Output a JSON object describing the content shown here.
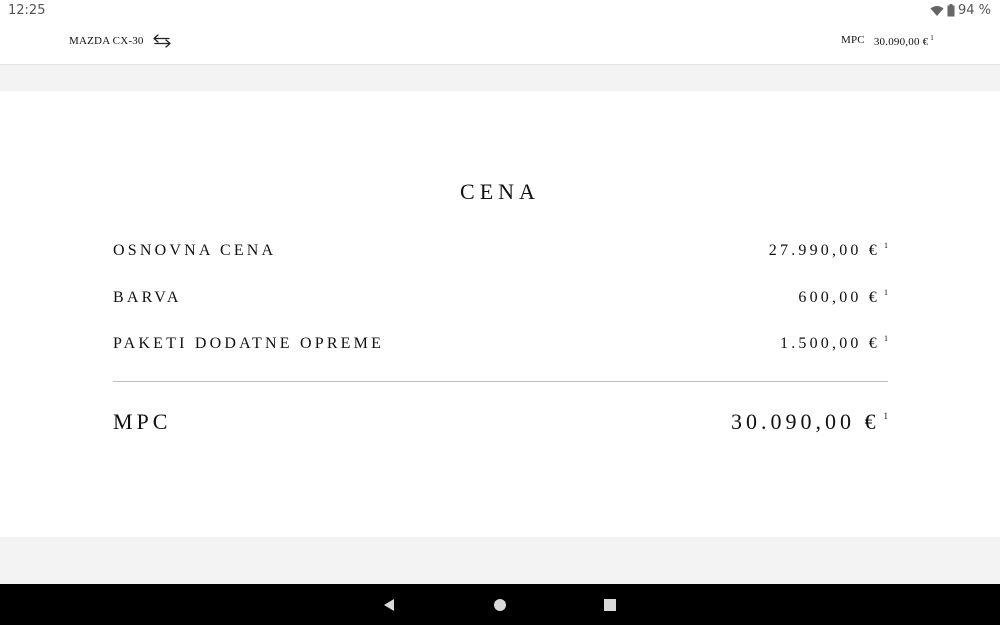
{
  "status_bar": {
    "time": "12:25",
    "battery": "94 %",
    "icons": [
      "wifi-icon",
      "battery-icon"
    ]
  },
  "header": {
    "model_name": "MAZDA CX-30",
    "price_label": "MPC",
    "price_value": "30.090,00 €",
    "footnote": "1"
  },
  "price_panel": {
    "title": "CENA",
    "rows": [
      {
        "label": "OSNOVNA CENA",
        "value": "27.990,00 €",
        "footnote": "1"
      },
      {
        "label": "BARVA",
        "value": "600,00 €",
        "footnote": "1"
      },
      {
        "label": "PAKETI DODATNE OPREME",
        "value": "1.500,00 €",
        "footnote": "1"
      }
    ],
    "total": {
      "label": "MPC",
      "value": "30.090,00 €",
      "footnote": "1"
    }
  },
  "nav_bar": {
    "buttons": [
      "back-icon",
      "home-icon",
      "recents-icon"
    ]
  },
  "colors": {
    "background": "#f3f3f3",
    "panel": "#ffffff",
    "text": "#111111",
    "divider": "#bdbdbd",
    "nav_bar": "#000000"
  }
}
